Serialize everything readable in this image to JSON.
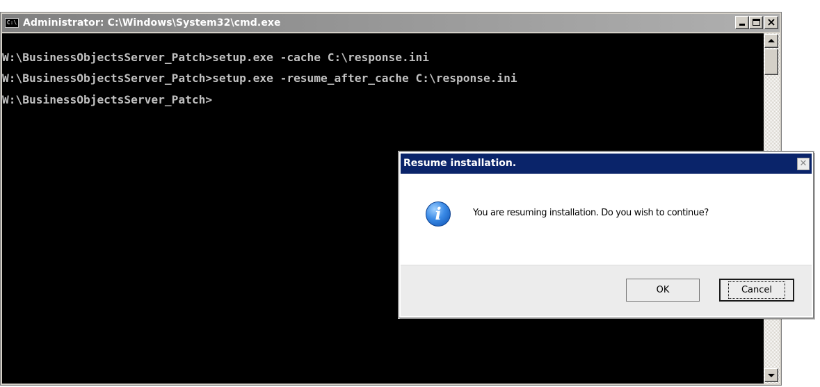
{
  "cmd_window": {
    "title": "Administrator: C:\\Windows\\System32\\cmd.exe",
    "icon_text": "C:\\",
    "lines": [
      "W:\\BusinessObjectsServer_Patch>setup.exe -cache C:\\response.ini",
      "W:\\BusinessObjectsServer_Patch>setup.exe -resume_after_cache C:\\response.ini",
      "W:\\BusinessObjectsServer_Patch>"
    ],
    "colors": {
      "console_bg": "#000000",
      "console_text": "#c0c0c0",
      "titlebar": "#808080"
    }
  },
  "dialog": {
    "title": "Resume installation.",
    "message": "You are resuming installation. Do you wish to continue?",
    "icon_glyph": "i",
    "buttons": {
      "ok": "OK",
      "cancel": "Cancel"
    },
    "close_glyph": "✕",
    "colors": {
      "titlebar": "#0a246a"
    }
  },
  "icons": [
    "cmd-app-icon",
    "minimize-icon",
    "maximize-icon",
    "close-icon",
    "info-icon",
    "scroll-up-icon",
    "scroll-down-icon"
  ]
}
